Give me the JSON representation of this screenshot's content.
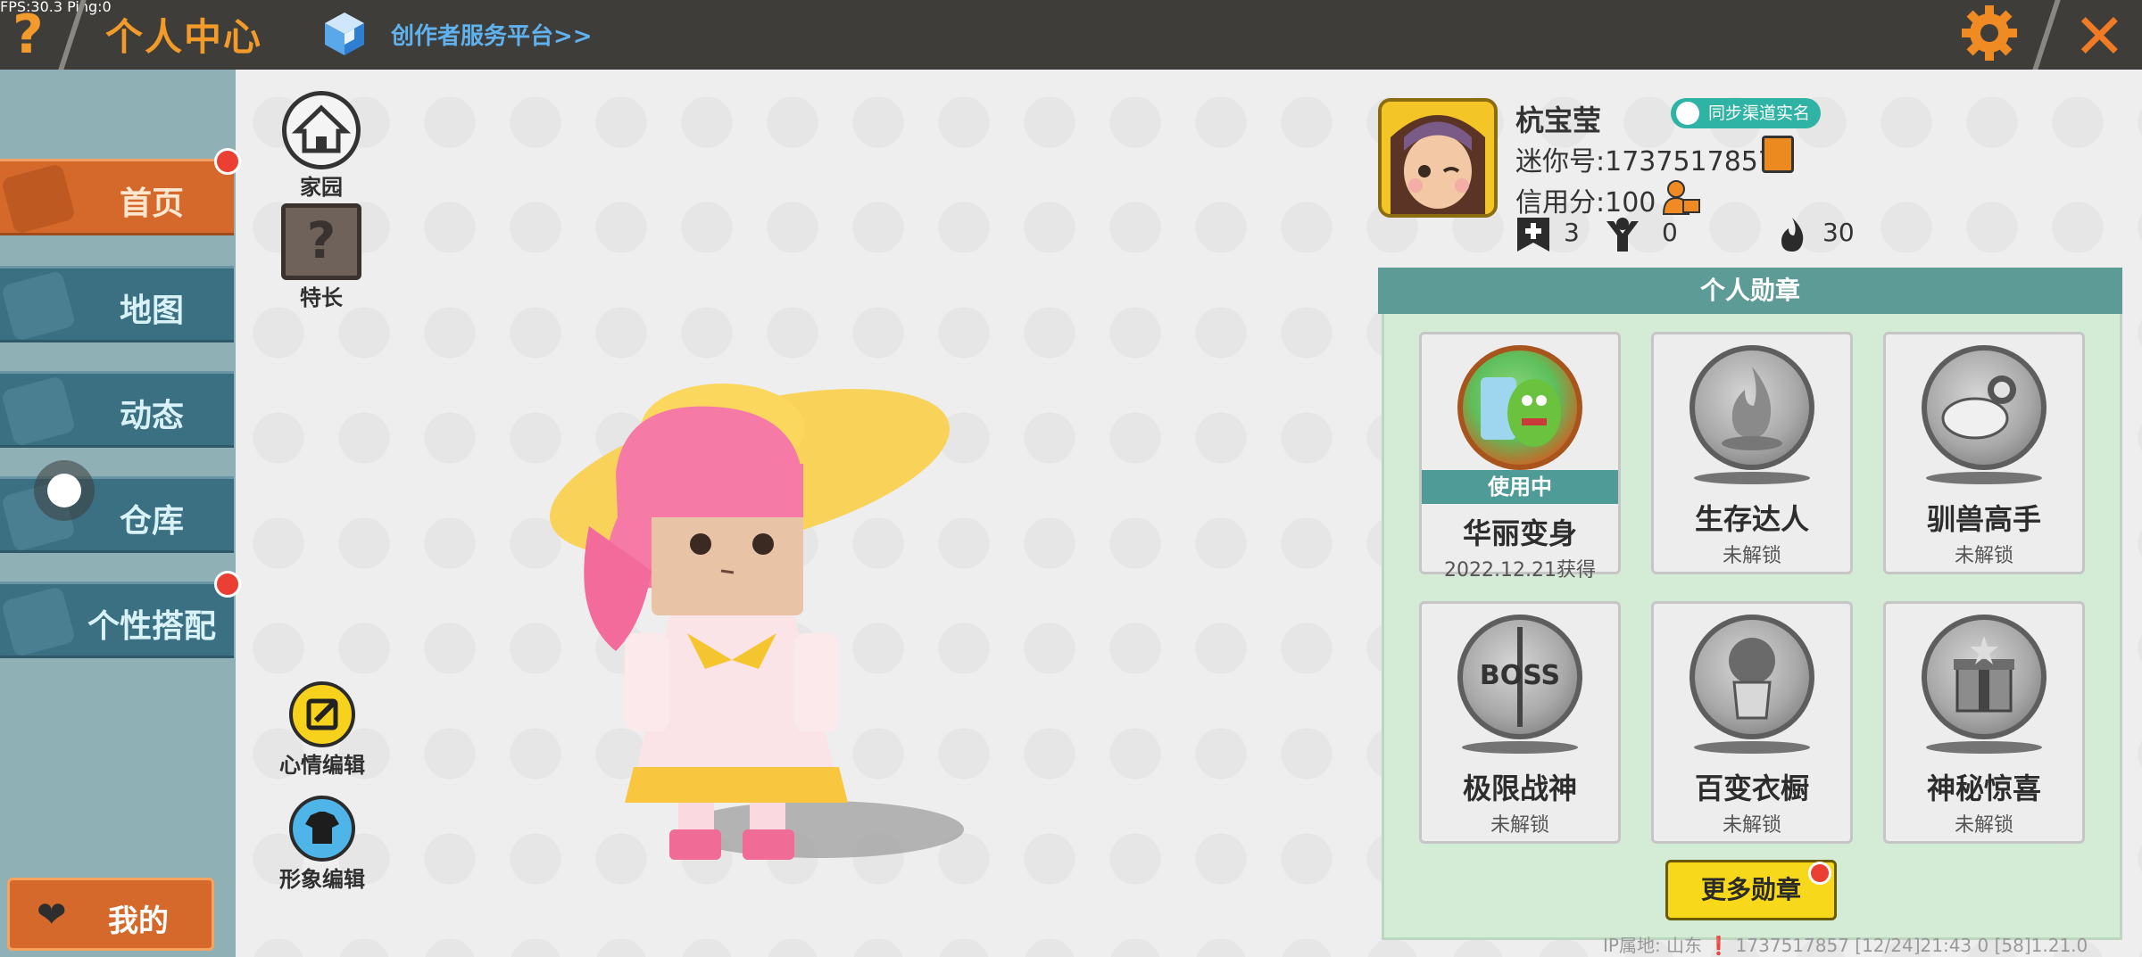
{
  "topbar": {
    "fps": "FPS:30.3  Ping:0",
    "help_icon": "question-icon",
    "title": "个人中心",
    "creator_link": "创作者服务平台>>",
    "settings_icon": "gear-icon",
    "close_icon": "close-icon"
  },
  "sidebar": {
    "items": [
      {
        "label": "首页",
        "icon": "home-icon",
        "active": true,
        "badge": true
      },
      {
        "label": "地图",
        "icon": "map-icon",
        "active": false,
        "badge": false
      },
      {
        "label": "动态",
        "icon": "bell-icon",
        "active": false,
        "badge": false
      },
      {
        "label": "仓库",
        "icon": "storage-icon",
        "active": false,
        "badge": false
      },
      {
        "label": "个性搭配",
        "icon": "outfit-icon",
        "active": false,
        "badge": true
      }
    ],
    "mine_label": "我的"
  },
  "left_icons": {
    "home": "家园",
    "talent": "特长",
    "mood_edit": "心情编辑",
    "image_edit": "形象编辑"
  },
  "profile": {
    "name": "杭宝莹",
    "realname_badge": "同步渠道实名",
    "mini_id": "迷你号:1737517857",
    "credit": "信用分:100",
    "stats": [
      {
        "icon": "add-friend-icon",
        "value": "3"
      },
      {
        "icon": "fans-icon",
        "value": "0"
      },
      {
        "icon": "flame-icon",
        "value": "30"
      }
    ]
  },
  "medals": {
    "header": "个人勋章",
    "items": [
      {
        "name": "华丽变身",
        "status": "2022.12.21获得",
        "using": "使用中",
        "unlocked": true
      },
      {
        "name": "生存达人",
        "status": "未解锁",
        "unlocked": false
      },
      {
        "name": "驯兽高手",
        "status": "未解锁",
        "unlocked": false
      },
      {
        "name": "极限战神",
        "status": "未解锁",
        "unlocked": false
      },
      {
        "name": "百变衣橱",
        "status": "未解锁",
        "unlocked": false
      },
      {
        "name": "神秘惊喜",
        "status": "未解锁",
        "unlocked": false
      }
    ],
    "more_button": "更多勋章"
  },
  "footer": "IP属地: 山东 ❗    1737517857    [12/24]21:43 0   [58]1.21.0",
  "colors": {
    "topbar": "#3f3d3a",
    "accent_orange": "#d4692b",
    "nav_teal": "#3b6f82",
    "medal_header": "#5c9b96",
    "more_button": "#f7d81a"
  }
}
